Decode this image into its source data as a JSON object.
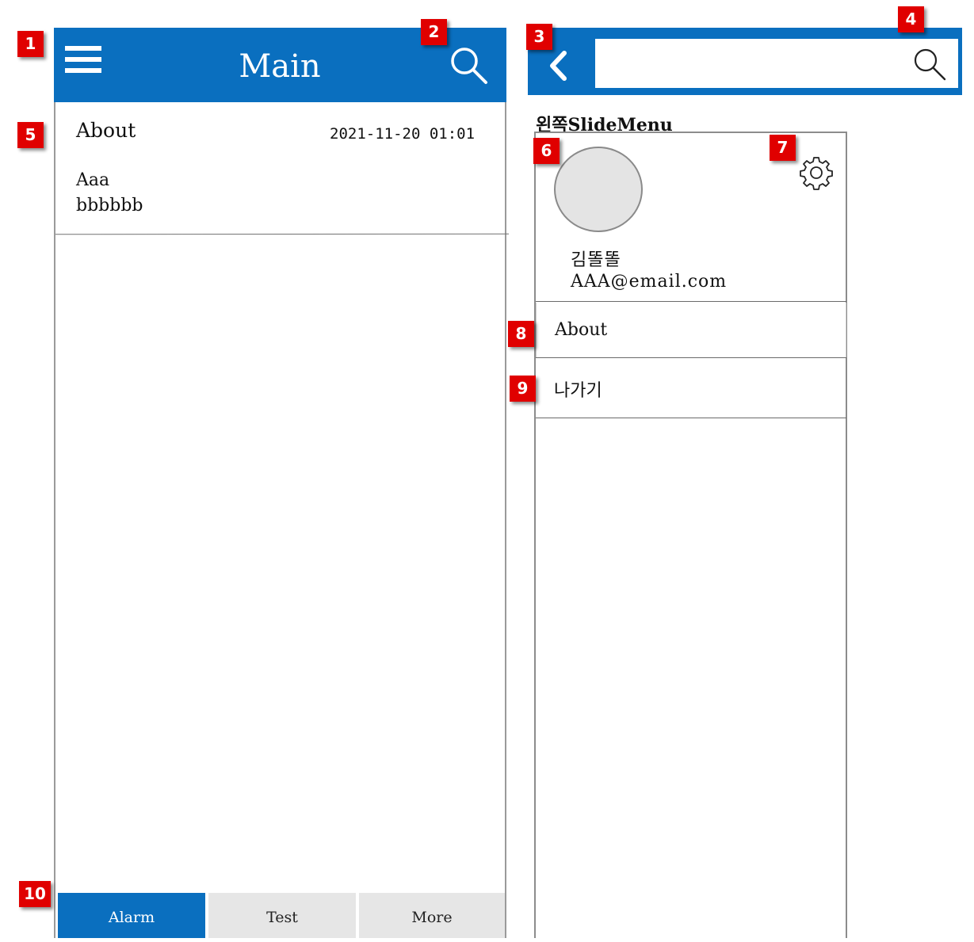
{
  "left_screen": {
    "header": {
      "title": "Main"
    },
    "list_item": {
      "title": "About",
      "date": "2021-11-20 01:01",
      "body_lines": [
        "Aaa",
        "bbbbbb"
      ]
    },
    "tabs": [
      {
        "label": "Alarm",
        "active": true
      },
      {
        "label": "Test",
        "active": false
      },
      {
        "label": "More",
        "active": false
      }
    ]
  },
  "right_screen": {
    "search": {
      "value": "",
      "placeholder": ""
    },
    "slide_menu_label": "왼쪽SlideMenu",
    "profile": {
      "name": "김똘똘",
      "email": "AAA@email.com"
    },
    "menu_items": [
      {
        "label": "About"
      },
      {
        "label": "나가기"
      }
    ]
  },
  "annotations": [
    "1",
    "2",
    "3",
    "4",
    "5",
    "6",
    "7",
    "8",
    "9",
    "10"
  ],
  "colors": {
    "header_blue": "#0a6fbf",
    "badge_red": "#e00000",
    "tab_inactive": "#e6e6e6"
  },
  "icons": [
    "hamburger-menu-icon",
    "search-icon",
    "back-chevron-icon",
    "gear-icon"
  ]
}
